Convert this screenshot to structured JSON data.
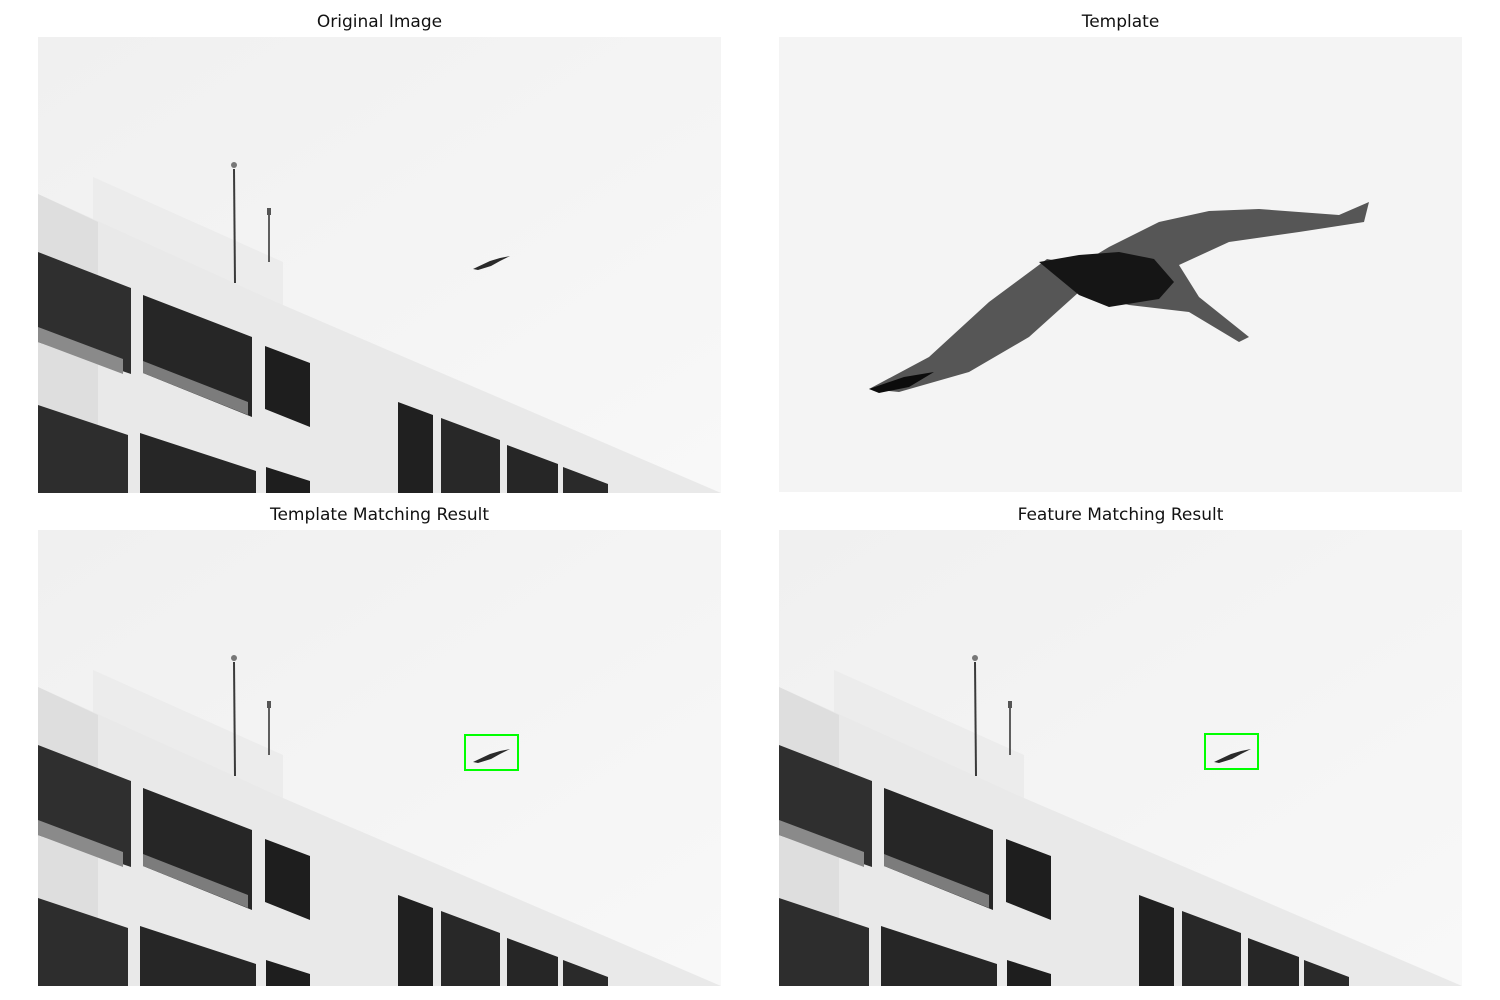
{
  "figure": {
    "panels": [
      {
        "title": "Original Image"
      },
      {
        "title": "Template"
      },
      {
        "title": "Template Matching Result"
      },
      {
        "title": "Feature Matching Result"
      }
    ],
    "image": "grayscale photo of white building corner with balconies, two antenna poles, and a flying bird in the sky",
    "box_color": "#00ff00"
  }
}
